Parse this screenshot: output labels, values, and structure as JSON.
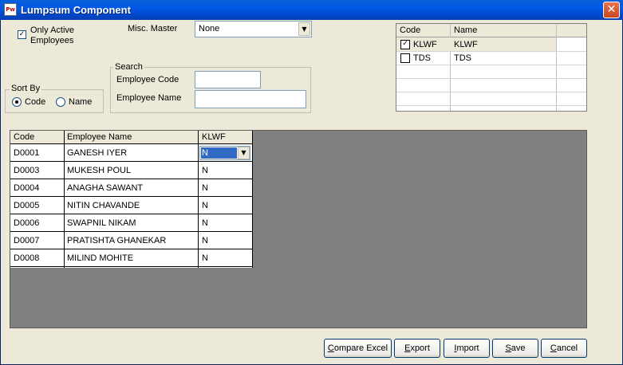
{
  "window": {
    "title": "Lumpsum Component",
    "app_icon": "Pw",
    "close_glyph": "✕"
  },
  "filters": {
    "only_active_line1": "Only Active",
    "only_active_line2": "Employees",
    "only_active_checked": true,
    "misc_master_label": "Misc. Master",
    "misc_master_value": "None"
  },
  "sort_by": {
    "label": "Sort By",
    "options": [
      "Code",
      "Name"
    ],
    "selected": "Code"
  },
  "search": {
    "label": "Search",
    "employee_code_label": "Employee Code",
    "employee_name_label": "Employee Name",
    "employee_code_value": "",
    "employee_name_value": ""
  },
  "components": {
    "headers": [
      "Code",
      "Name"
    ],
    "rows": [
      {
        "code": "KLWF",
        "name": "KLWF",
        "checked": true
      },
      {
        "code": "TDS",
        "name": "TDS",
        "checked": false
      }
    ]
  },
  "employees": {
    "headers": [
      "Code",
      "Employee Name",
      "KLWF"
    ],
    "rows": [
      {
        "code": "D0001",
        "name": "GANESH IYER",
        "klwf": "N"
      },
      {
        "code": "D0003",
        "name": "MUKESH POUL",
        "klwf": "N"
      },
      {
        "code": "D0004",
        "name": "ANAGHA SAWANT",
        "klwf": "N"
      },
      {
        "code": "D0005",
        "name": "NITIN CHAVANDE",
        "klwf": "N"
      },
      {
        "code": "D0006",
        "name": "SWAPNIL NIKAM",
        "klwf": "N"
      },
      {
        "code": "D0007",
        "name": "PRATISHTA GHANEKAR",
        "klwf": "N"
      },
      {
        "code": "D0008",
        "name": "MILIND MOHITE",
        "klwf": "N"
      }
    ]
  },
  "buttons": {
    "compare_excel": {
      "ul": "C",
      "rest": "ompare Excel"
    },
    "export": {
      "ul": "E",
      "rest": "xport"
    },
    "import": {
      "ul": "I",
      "rest": "mport"
    },
    "save": {
      "ul": "S",
      "rest": "ave"
    },
    "cancel": {
      "ul": "C",
      "rest": "ancel"
    }
  },
  "colors": {
    "titlebar": "#0054e3",
    "grid_bg": "#808080",
    "selection": "#316ac5",
    "close": "#d4542d"
  }
}
